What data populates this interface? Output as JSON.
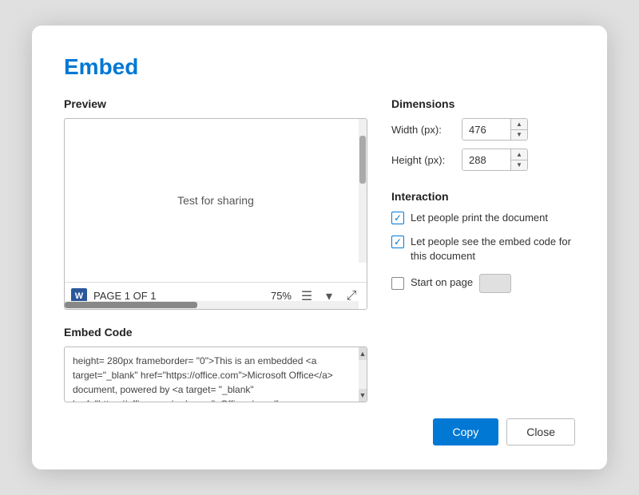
{
  "dialog": {
    "title": "Embed"
  },
  "preview": {
    "section_label": "Preview",
    "document_text": "Test for sharing",
    "page_info": "PAGE 1 OF 1",
    "zoom": "75%"
  },
  "embed_code": {
    "section_label": "Embed Code",
    "code_text": "height= 280px frameborder= \"0\">This is an embedded <a target=\"_blank\" href=\"https://office.com\">Microsoft Office</a> document, powered by <a target= \"_blank\" href=\"https://office.com/webapps\">Office</a>.</frame>"
  },
  "dimensions": {
    "section_label": "Dimensions",
    "width_label": "Width (px):",
    "width_value": "476",
    "height_label": "Height (px):",
    "height_value": "288"
  },
  "interaction": {
    "section_label": "Interaction",
    "print_label": "Let people print the document",
    "print_checked": true,
    "embed_code_label": "Let people see the embed code for this document",
    "embed_code_checked": true,
    "start_on_page_label": "Start on page"
  },
  "footer": {
    "copy_label": "Copy",
    "close_label": "Close"
  },
  "icons": {
    "spinner_up": "▲",
    "spinner_down": "▼",
    "scroll_up": "▲",
    "scroll_down": "▼",
    "word": "W",
    "layout_icon": "☰",
    "expand_icon": "⤢"
  }
}
